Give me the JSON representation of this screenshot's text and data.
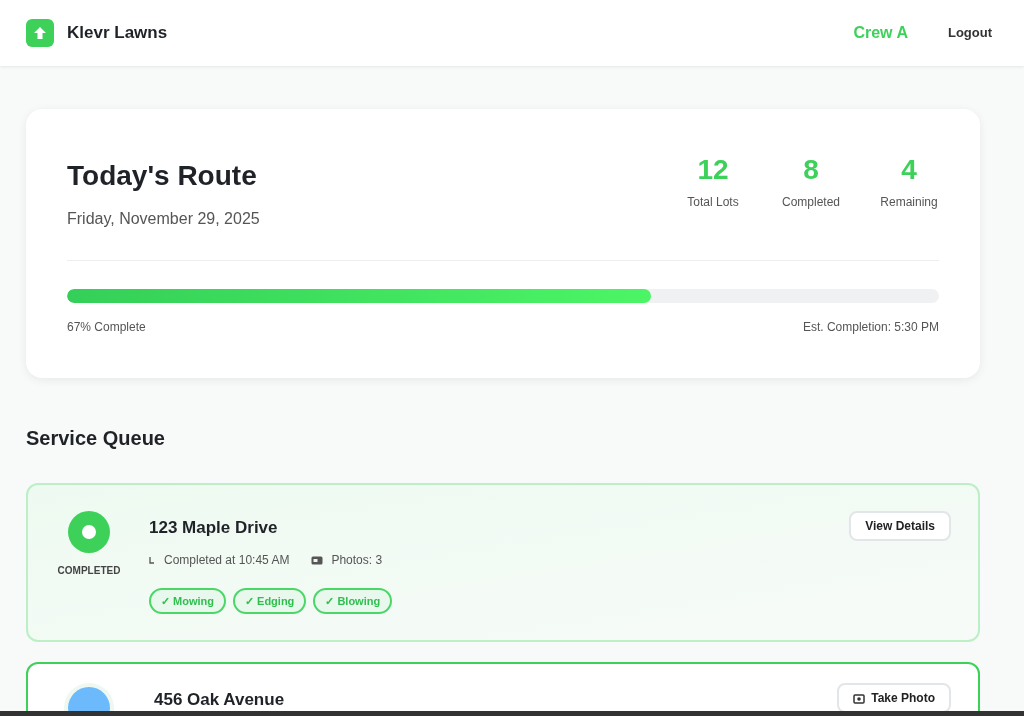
{
  "header": {
    "brand": "Klevr Lawns",
    "crew": "Crew A",
    "logout": "Logout"
  },
  "route": {
    "title": "Today's Route",
    "date": "Friday, November 29, 2025",
    "stats": [
      {
        "value": "12",
        "label": "Total Lots"
      },
      {
        "value": "8",
        "label": "Completed"
      },
      {
        "value": "4",
        "label": "Remaining"
      }
    ],
    "progress": {
      "level": 0.67,
      "label": "67% Complete",
      "estimate": "Est. Completion: 5:30 PM"
    }
  },
  "queue": {
    "title": "Service Queue",
    "items": [
      {
        "kind": "completed",
        "status": "COMPLETED",
        "address": "123 Maple Drive",
        "time": "Completed at 10:45 AM",
        "photos": "Photos: 3",
        "tags": [
          "✓ Mowing",
          "✓ Edging",
          "✓ Blowing"
        ],
        "action": "View Details"
      },
      {
        "kind": "in_progress",
        "address": "456 Oak Avenue",
        "action": "Take Photo"
      }
    ]
  }
}
